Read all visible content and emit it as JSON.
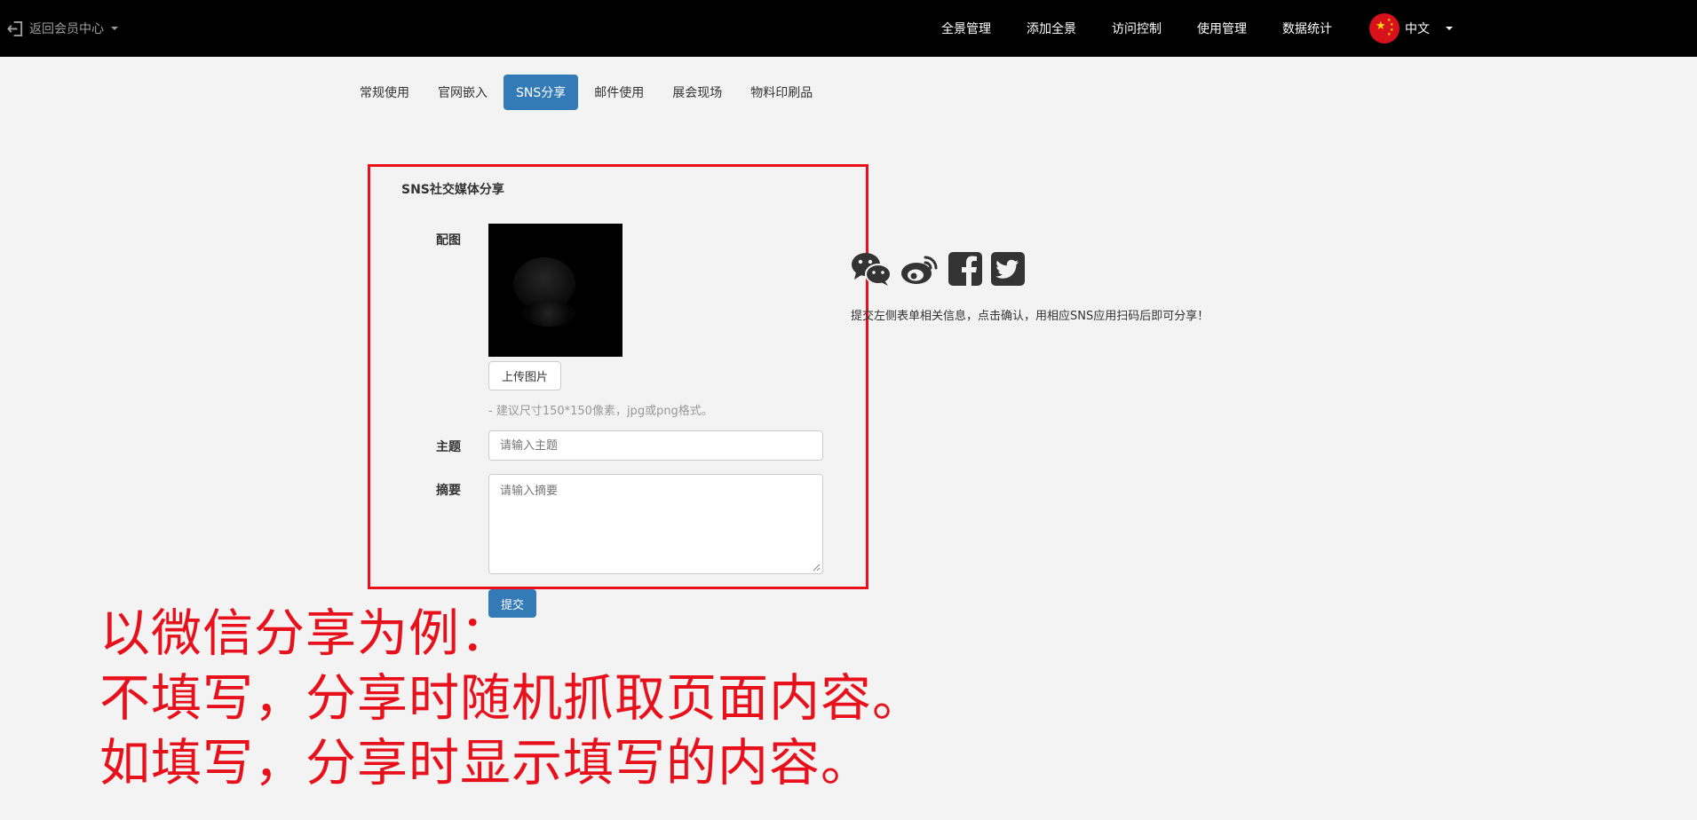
{
  "topbar": {
    "back_label": "返回会员中心",
    "nav": [
      "全景管理",
      "添加全景",
      "访问控制",
      "使用管理",
      "数据统计"
    ],
    "language": "中文"
  },
  "tabs": [
    {
      "label": "常规使用",
      "active": false
    },
    {
      "label": "官网嵌入",
      "active": false
    },
    {
      "label": "SNS分享",
      "active": true
    },
    {
      "label": "邮件使用",
      "active": false
    },
    {
      "label": "展会现场",
      "active": false
    },
    {
      "label": "物料印刷品",
      "active": false
    }
  ],
  "form": {
    "title": "SNS社交媒体分享",
    "image_label": "配图",
    "upload_button": "上传图片",
    "hint": "- 建议尺寸150*150像素，jpg或png格式。",
    "subject_label": "主题",
    "subject_placeholder": "请输入主题",
    "summary_label": "摘要",
    "summary_placeholder": "请输入摘要",
    "submit_button": "提交"
  },
  "sns": {
    "icons": [
      "wechat-icon",
      "weibo-icon",
      "facebook-icon",
      "twitter-icon"
    ],
    "description": "提交左侧表单相关信息，点击确认，用相应SNS应用扫码后即可分享！"
  },
  "annotation": {
    "line1": "以微信分享为例：",
    "line2": "不填写，分享时随机抓取页面内容。",
    "line3": "如填写，分享时显示填写的内容。"
  },
  "colors": {
    "topbar": "#000000",
    "accent": "#337ab7",
    "annotation": "#e8111b",
    "background": "#f3f3f3"
  }
}
